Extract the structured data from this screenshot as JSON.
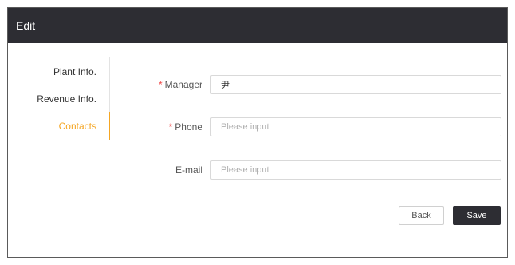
{
  "dialog": {
    "title": "Edit"
  },
  "nav": {
    "items": [
      {
        "label": "Plant Info."
      },
      {
        "label": "Revenue Info."
      },
      {
        "label": "Contacts"
      }
    ],
    "active": "Contacts",
    "accent_color": "#f5a623"
  },
  "form": {
    "manager": {
      "required_mark": "*",
      "label": "Manager",
      "value": "尹",
      "placeholder": "Please input"
    },
    "phone": {
      "required_mark": "*",
      "label": "Phone",
      "value": "",
      "placeholder": "Please input"
    },
    "email": {
      "label": "E-mail",
      "value": "",
      "placeholder": "Please input"
    }
  },
  "actions": {
    "back_label": "Back",
    "save_label": "Save"
  },
  "colors": {
    "header_bg": "#2d2d33",
    "required": "#f04848"
  }
}
